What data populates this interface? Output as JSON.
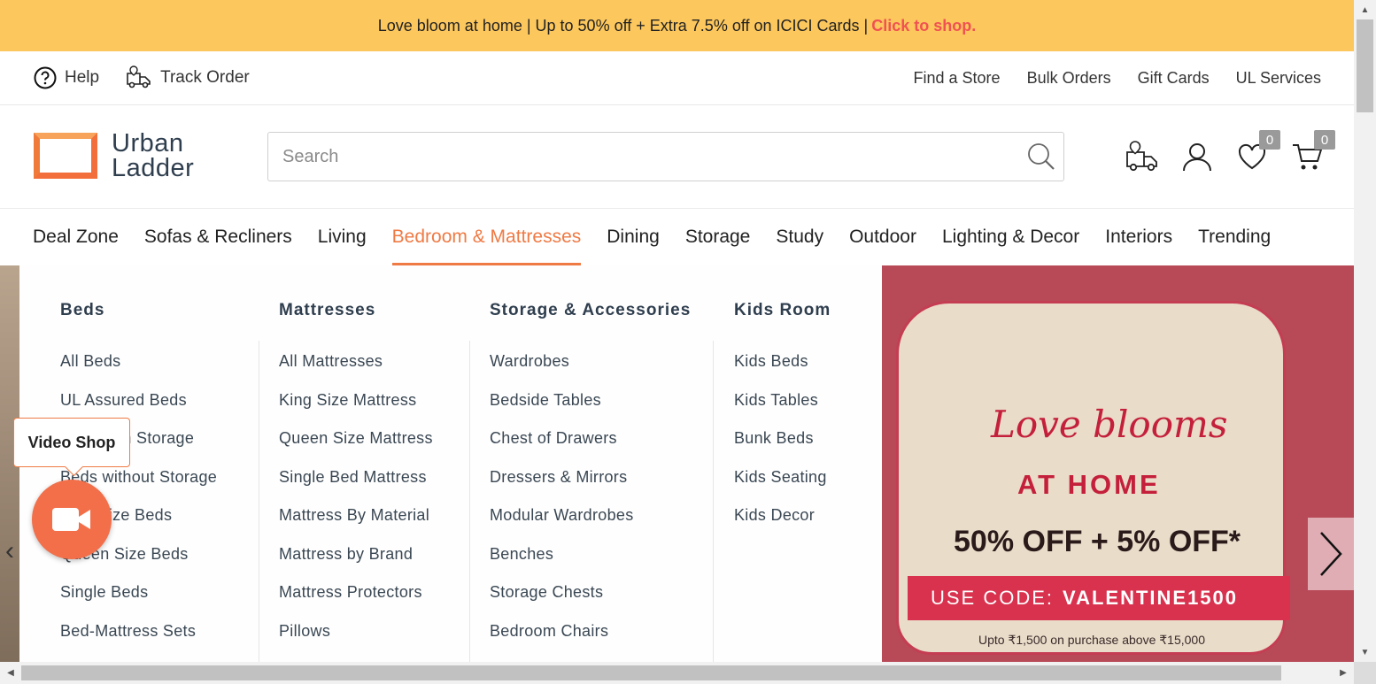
{
  "promo": {
    "text": "Love bloom at home | Up to 50% off + Extra 7.5% off on ICICI Cards |",
    "cta": "Click to shop.",
    "bg_color": "#fcc75d",
    "cta_color": "#f05252"
  },
  "utility": {
    "help": "Help",
    "track_order": "Track Order",
    "links": [
      "Find a Store",
      "Bulk Orders",
      "Gift Cards",
      "UL Services"
    ]
  },
  "header": {
    "logo_line1": "Urban",
    "logo_line2": "Ladder",
    "search_placeholder": "Search",
    "wishlist_count": "0",
    "cart_count": "0"
  },
  "nav": {
    "items": [
      "Deal Zone",
      "Sofas & Recliners",
      "Living",
      "Bedroom & Mattresses",
      "Dining",
      "Storage",
      "Study",
      "Outdoor",
      "Lighting & Decor",
      "Interiors",
      "Trending"
    ],
    "active_index": 3,
    "accent_color": "#ef7a44"
  },
  "mega_menu": {
    "columns": [
      {
        "title": "Beds",
        "items": [
          "All Beds",
          "UL Assured Beds",
          "Beds with Storage",
          "Beds without Storage",
          "King Size Beds",
          "Queen Size Beds",
          "Single Beds",
          "Bed-Mattress Sets"
        ]
      },
      {
        "title": "Mattresses",
        "items": [
          "All Mattresses",
          "King Size Mattress",
          "Queen Size Mattress",
          "Single Bed Mattress",
          "Mattress By Material",
          "Mattress by Brand",
          "Mattress Protectors",
          "Pillows"
        ]
      },
      {
        "title": "Storage & Accessories",
        "items": [
          "Wardrobes",
          "Bedside Tables",
          "Chest of Drawers",
          "Dressers & Mirrors",
          "Modular Wardrobes",
          "Benches",
          "Storage Chests",
          "Bedroom Chairs"
        ]
      },
      {
        "title": "Kids Room",
        "items": [
          "Kids Beds",
          "Kids Tables",
          "Bunk Beds",
          "Kids Seating",
          "Kids Decor"
        ]
      }
    ]
  },
  "banner": {
    "script": "Love blooms",
    "headline": "AT HOME",
    "offer": "50% OFF + 5% OFF*",
    "code_label": "USE CODE:",
    "code": "VALENTINE1500",
    "fine_print": "Upto ₹1,500 on purchase above ₹15,000"
  },
  "video_shop": {
    "label": "Video Shop",
    "color": "#f26f4a"
  }
}
